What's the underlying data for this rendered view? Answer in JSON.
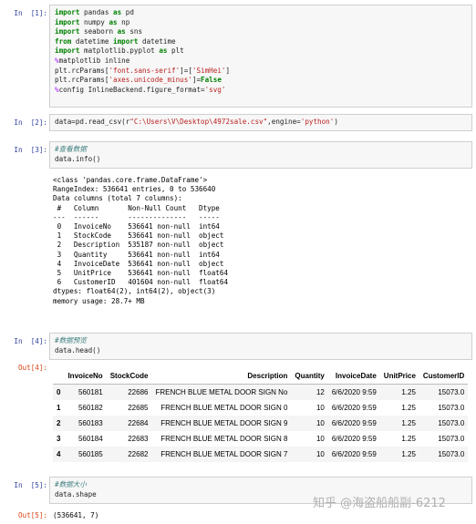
{
  "cells": [
    {
      "prompt": "In  [1]:",
      "code": [
        [
          [
            "kw",
            "import"
          ],
          [
            "p",
            " pandas "
          ],
          [
            "kw",
            "as"
          ],
          [
            "p",
            " pd"
          ]
        ],
        [
          [
            "kw",
            "import"
          ],
          [
            "p",
            " numpy "
          ],
          [
            "kw",
            "as"
          ],
          [
            "p",
            " np"
          ]
        ],
        [
          [
            "kw",
            "import"
          ],
          [
            "p",
            " seaborn "
          ],
          [
            "kw",
            "as"
          ],
          [
            "p",
            " sns"
          ]
        ],
        [
          [
            "kw",
            "from"
          ],
          [
            "p",
            " datetime "
          ],
          [
            "kw",
            "import"
          ],
          [
            "p",
            " datetime"
          ]
        ],
        [
          [
            "kw",
            "import"
          ],
          [
            "p",
            " matplotlib.pyplot "
          ],
          [
            "kw",
            "as"
          ],
          [
            "p",
            " plt"
          ]
        ],
        [
          [
            "mg",
            "%"
          ],
          [
            "p",
            "matplotlib inline"
          ]
        ],
        [
          [
            "p",
            "plt.rcParams["
          ],
          [
            "str",
            "'font.sans-serif'"
          ],
          [
            "p",
            "]=["
          ],
          [
            "str",
            "'SimHei'"
          ],
          [
            "p",
            "]"
          ]
        ],
        [
          [
            "p",
            "plt.rcParams["
          ],
          [
            "str",
            "'axes.unicode_minus'"
          ],
          [
            "p",
            "]="
          ],
          [
            "kw",
            "False"
          ]
        ],
        [
          [
            "mg",
            "%"
          ],
          [
            "p",
            "config InlineBackend.figure_format="
          ],
          [
            "str",
            "'svg'"
          ]
        ]
      ]
    },
    {
      "prompt": "In  [2]:",
      "code": [
        [
          [
            "p",
            "data=pd.read_csv(r"
          ],
          [
            "str",
            "\"C:\\Users\\V\\Desktop\\4972sale.csv\""
          ],
          [
            "p",
            ",engine="
          ],
          [
            "str",
            "'python'"
          ],
          [
            "p",
            ")"
          ]
        ]
      ]
    },
    {
      "prompt": "In  [3]:",
      "code": [
        [
          [
            "cm",
            "#查看数据"
          ]
        ],
        [
          [
            "p",
            "data.info()"
          ]
        ]
      ]
    },
    {
      "prompt": "In  [4]:",
      "code": [
        [
          [
            "cm",
            "#数据预览"
          ]
        ],
        [
          [
            "p",
            "data.head()"
          ]
        ]
      ]
    },
    {
      "prompt": "In  [5]:",
      "code": [
        [
          [
            "cm",
            "#数据大小"
          ]
        ],
        [
          [
            "p",
            "data.shape"
          ]
        ]
      ]
    }
  ],
  "info_output": "<class 'pandas.core.frame.DataFrame'>\nRangeIndex: 536641 entries, 0 to 536640\nData columns (total 7 columns):\n #   Column       Non-Null Count   Dtype  \n---  ------       --------------   -----  \n 0   InvoiceNo    536641 non-null  int64  \n 1   StockCode    536641 non-null  object \n 2   Description  535187 non-null  object \n 3   Quantity     536641 non-null  int64  \n 4   InvoiceDate  536641 non-null  object \n 5   UnitPrice    536641 non-null  float64\n 6   CustomerID   401604 non-null  float64\ndtypes: float64(2), int64(2), object(3)\nmemory usage: 28.7+ MB",
  "head_output": {
    "prompt": "Out[4]:",
    "columns": [
      "",
      "InvoiceNo",
      "StockCode",
      "Description",
      "Quantity",
      "InvoiceDate",
      "UnitPrice",
      "CustomerID"
    ],
    "rows": [
      [
        "0",
        "560181",
        "22686",
        "FRENCH BLUE METAL DOOR SIGN No",
        "12",
        "6/6/2020 9:59",
        "1.25",
        "15073.0"
      ],
      [
        "1",
        "560182",
        "22685",
        "FRENCH BLUE METAL DOOR SIGN 0",
        "10",
        "6/6/2020 9:59",
        "1.25",
        "15073.0"
      ],
      [
        "2",
        "560183",
        "22684",
        "FRENCH BLUE METAL DOOR SIGN 9",
        "10",
        "6/6/2020 9:59",
        "1.25",
        "15073.0"
      ],
      [
        "3",
        "560184",
        "22683",
        "FRENCH BLUE METAL DOOR SIGN 8",
        "10",
        "6/6/2020 9:59",
        "1.25",
        "15073.0"
      ],
      [
        "4",
        "560185",
        "22682",
        "FRENCH BLUE METAL DOOR SIGN 7",
        "10",
        "6/6/2020 9:59",
        "1.25",
        "15073.0"
      ]
    ]
  },
  "shape_output": {
    "prompt": "Out[5]:",
    "text": "(536641, 7)"
  },
  "watermark": "知乎 @海盗船船副-6212"
}
